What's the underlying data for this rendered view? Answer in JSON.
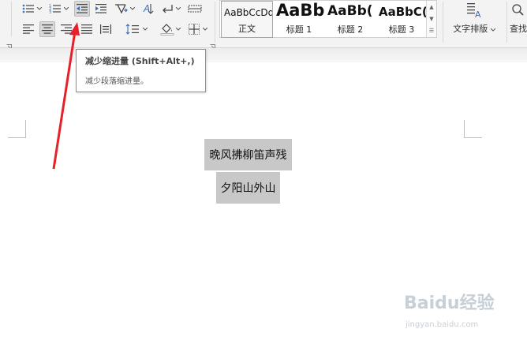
{
  "ribbon": {
    "styles": [
      {
        "sample": "AaBbCcDd",
        "label": "正文",
        "selected": true
      },
      {
        "sample": "AaBb",
        "label": "标题 1",
        "selected": false
      },
      {
        "sample": "AaBb(",
        "label": "标题 2",
        "selected": false
      },
      {
        "sample": "AaBbC(",
        "label": "标题 3",
        "selected": false
      }
    ],
    "text_layout_label": "文字排版",
    "find_label": "查找"
  },
  "tooltip": {
    "title": "减少缩进量 (Shift+Alt+,)",
    "description": "减少段落缩进量。"
  },
  "document": {
    "lines": [
      "晚风拂柳笛声残",
      "夕阳山外山"
    ],
    "highlight_color": "#c8c8c8"
  },
  "annotation": {
    "arrow_color": "#e8202a"
  },
  "watermark": {
    "brand": "Baidu经验",
    "url": "jingyan.baidu.com"
  }
}
